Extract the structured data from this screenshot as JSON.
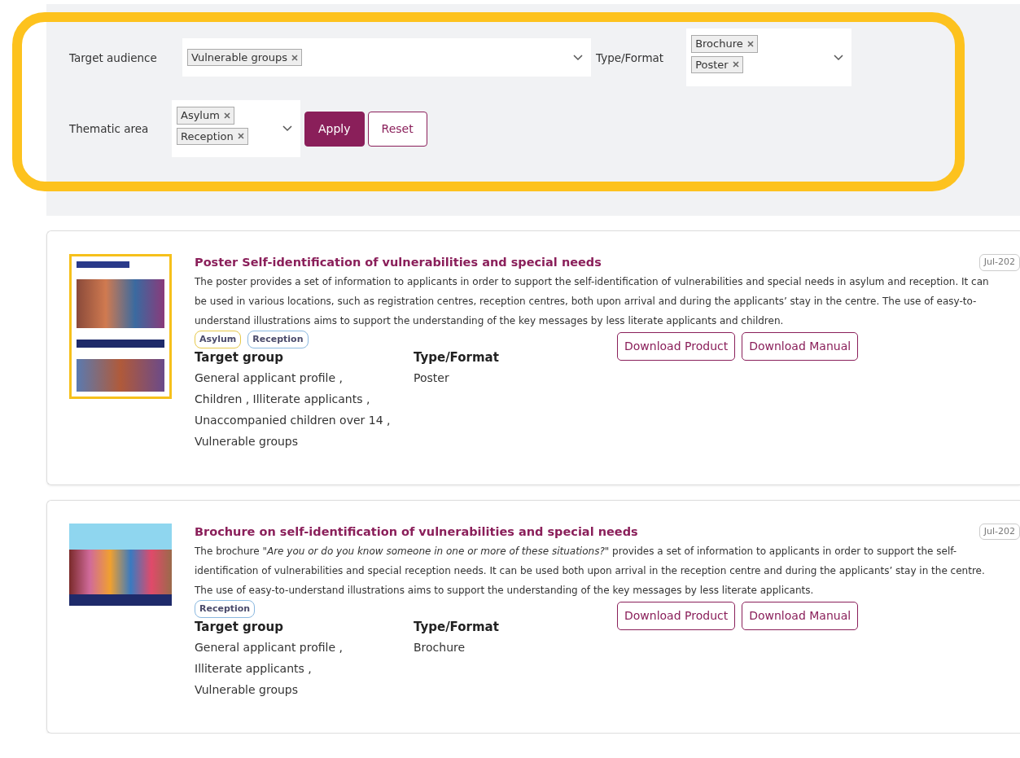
{
  "filters": {
    "highlighted": true,
    "target_audience": {
      "label": "Target audience",
      "chips": [
        "Vulnerable groups"
      ]
    },
    "type_format": {
      "label": "Type/Format",
      "chips": [
        "Brochure",
        "Poster"
      ]
    },
    "thematic_area": {
      "label": "Thematic area",
      "chips": [
        "Asylum",
        "Reception"
      ]
    },
    "apply": "Apply",
    "reset": "Reset"
  },
  "results": [
    {
      "kind": "poster",
      "title": "Poster Self-identification of vulnerabilities and special needs",
      "date": "Jul-202",
      "description": "The poster provides a set of information to applicants in order to support the self-identification of vulnerabilities and special needs in asylum and reception. It can be used in various locations, such as registration centres, reception centres, both upon arrival and during the applicants’ stay in the centre. The use of easy-to-understand illustrations aims to support the understanding of the key messages by less literate applicants and children.",
      "tags": [
        {
          "label": "Asylum",
          "color": "#e6c84a"
        },
        {
          "label": "Reception",
          "color": "#8ab8e0"
        }
      ],
      "target_group_heading": "Target group",
      "target_group_lines": [
        "General applicant profile ,",
        "Children , Illiterate applicants ,",
        "Unaccompanied children over 14 ,",
        "Vulnerable groups"
      ],
      "type_heading": "Type/Format",
      "type_value": "Poster",
      "buttons": [
        "Download Product",
        "Download Manual"
      ]
    },
    {
      "kind": "brochure",
      "title": "Brochure on self-identification of vulnerabilities and special needs",
      "date": "Jul-202",
      "description": "The brochure \"*Are you or do you know someone in one or more of these situations?*\" provides a set of information to applicants in order to support the self-identification of vulnerabilities and special reception needs. It can be used both upon arrival in the reception centre and during the applicants’ stay in the centre. The use of easy-to-understand illustrations aims to support the understanding of the key messages by less literate applicants.",
      "tags": [
        {
          "label": "Reception",
          "color": "#8ab8e0"
        }
      ],
      "target_group_heading": "Target group",
      "target_group_lines": [
        "General applicant profile ,",
        "Illiterate applicants ,",
        "Vulnerable groups"
      ],
      "type_heading": "Type/Format",
      "type_value": "Brochure",
      "buttons": [
        "Download Product",
        "Download Manual"
      ]
    }
  ]
}
